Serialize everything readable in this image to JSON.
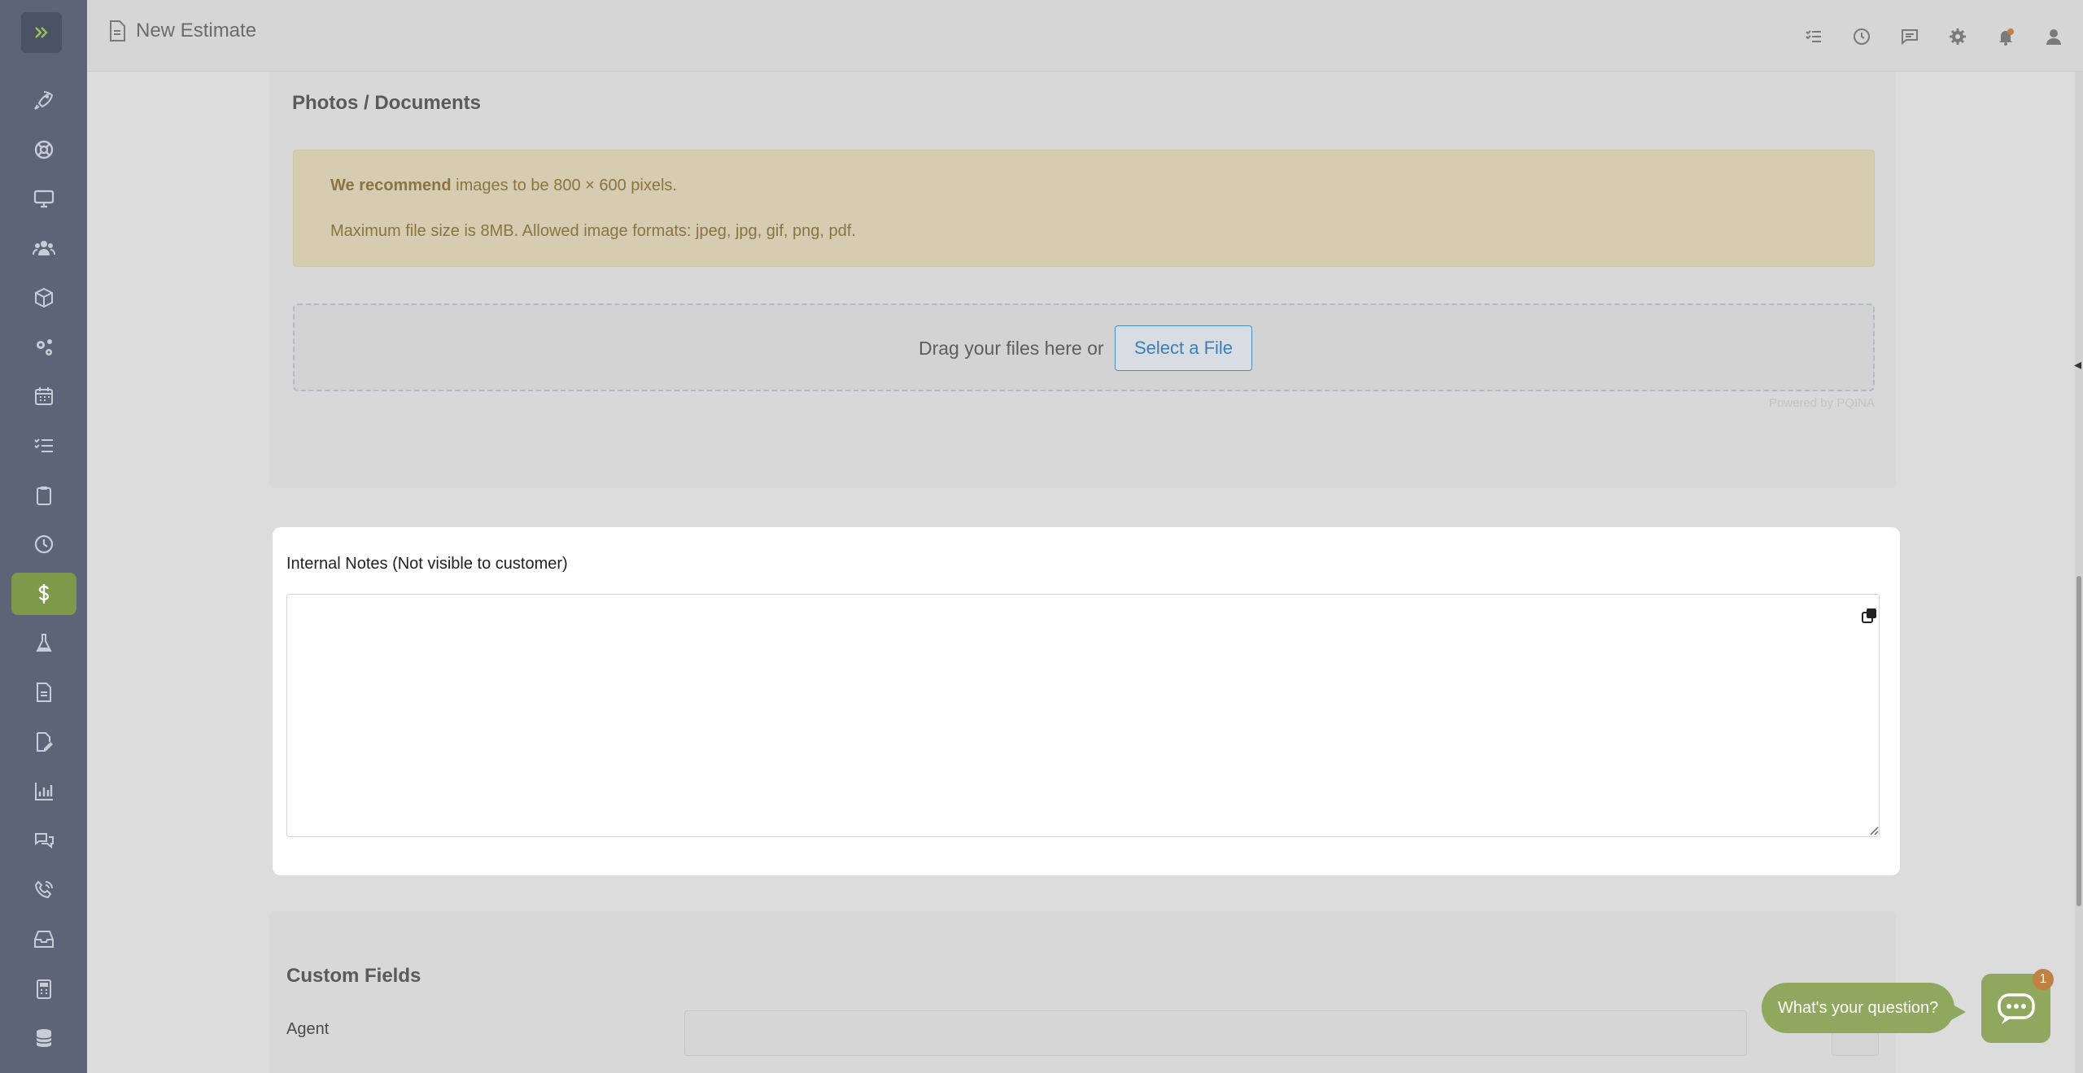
{
  "header": {
    "title": "New Estimate",
    "icons": [
      "tasks-icon",
      "clock-icon",
      "chat-icon",
      "gear-icon",
      "bell-icon",
      "user-icon"
    ]
  },
  "sidebar": {
    "items": [
      {
        "icon": "rocket-icon"
      },
      {
        "icon": "lifebuoy-icon"
      },
      {
        "icon": "monitor-icon"
      },
      {
        "icon": "users-icon"
      },
      {
        "icon": "box-icon"
      },
      {
        "icon": "gears-icon"
      },
      {
        "icon": "calendar-icon"
      },
      {
        "icon": "checklist-icon"
      },
      {
        "icon": "clipboard-icon"
      },
      {
        "icon": "clock-icon"
      },
      {
        "icon": "dollar-icon",
        "active": true
      },
      {
        "icon": "flask-icon"
      },
      {
        "icon": "document-icon"
      },
      {
        "icon": "signature-icon"
      },
      {
        "icon": "chart-icon"
      },
      {
        "icon": "comments-icon"
      },
      {
        "icon": "phone-icon"
      },
      {
        "icon": "inbox-icon"
      },
      {
        "icon": "calculator-icon"
      },
      {
        "icon": "database-icon"
      }
    ],
    "accent": "#7d9a4a"
  },
  "photos": {
    "title": "Photos / Documents",
    "alert_bold": "We recommend",
    "alert_line1_rest": " images to be 800 × 600 pixels.",
    "alert_line2": "Maximum file size is 8MB. Allowed image formats: jpeg, jpg, gif, png, pdf.",
    "drop_label": "Drag your files here or",
    "select_button": "Select a File",
    "powered_by": "Powered by PQINA"
  },
  "notes": {
    "label": "Internal Notes (Not visible to customer)",
    "value": ""
  },
  "custom_fields": {
    "title": "Custom Fields",
    "agent_label": "Agent",
    "agent_value": ""
  },
  "chat": {
    "prompt": "What's your question?",
    "badge": "1"
  }
}
